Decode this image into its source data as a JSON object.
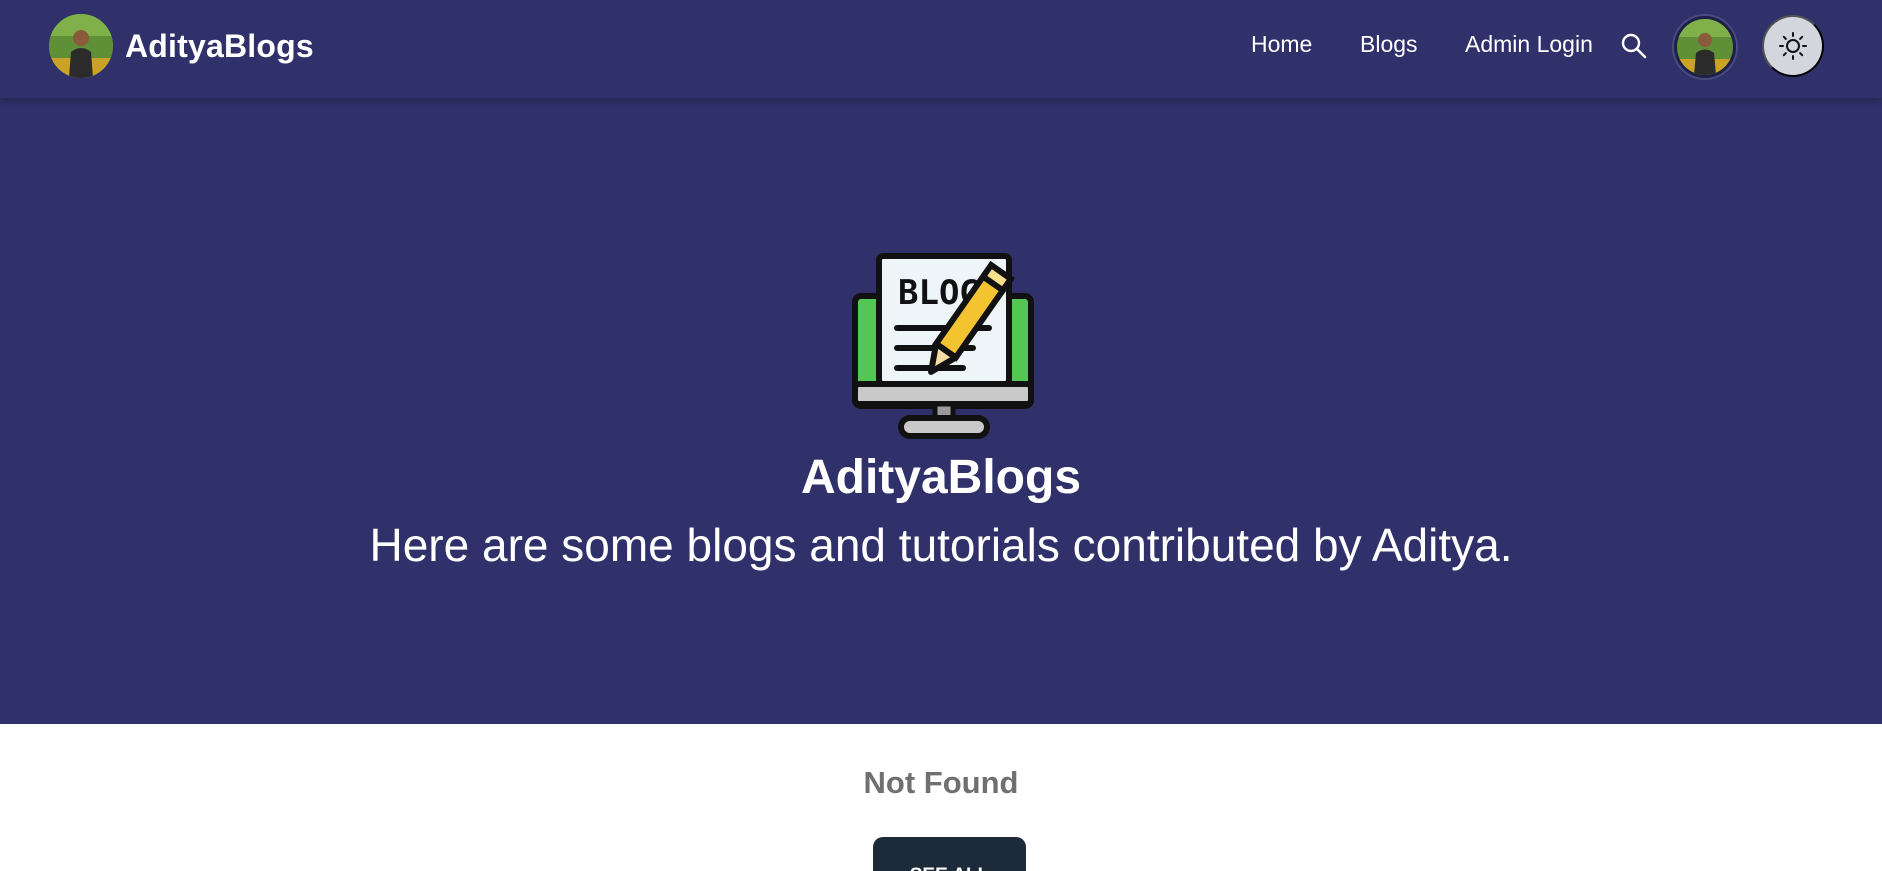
{
  "navbar": {
    "brand_name": "AdityaBlogs",
    "links": [
      {
        "label": "Home"
      },
      {
        "label": "Blogs"
      },
      {
        "label": "Admin Login"
      }
    ],
    "search_icon": "search-icon",
    "theme_icon": "sun-icon"
  },
  "hero": {
    "logo_text": "BLOG",
    "title": "AdityaBlogs",
    "subtitle": "Here are some blogs and tutorials contributed by Aditya."
  },
  "content": {
    "status": "Not Found",
    "see_all_label": "SEE ALL"
  },
  "colors": {
    "navbar_bg": "#30316a",
    "hero_bg": "#30316a",
    "text_primary": "#ffffff",
    "status_text": "#707070",
    "button_bg": "#1d2a3a",
    "theme_button_bg": "#d4d6de"
  }
}
